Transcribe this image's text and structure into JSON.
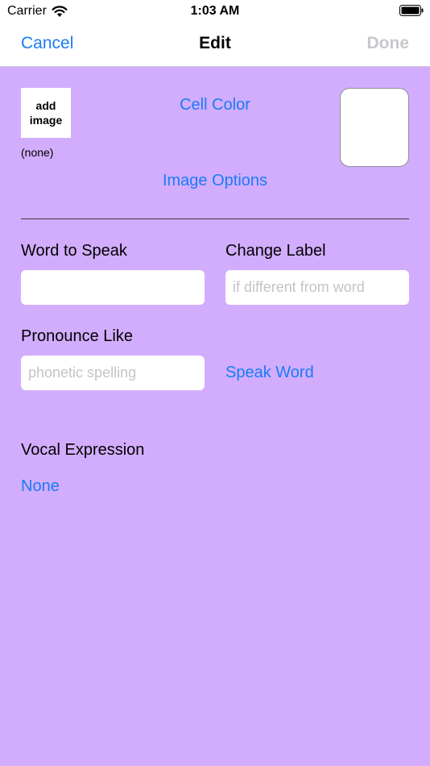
{
  "status_bar": {
    "carrier": "Carrier",
    "time": "1:03 AM",
    "wifi_icon": "wifi-icon",
    "battery_icon": "battery-icon"
  },
  "nav": {
    "cancel_label": "Cancel",
    "title": "Edit",
    "done_label": "Done"
  },
  "image_section": {
    "add_image_line1": "add",
    "add_image_line2": "image",
    "image_name": "(none)",
    "cell_color_label": "Cell Color",
    "image_options_label": "Image Options",
    "swatch_color": "#ffffff"
  },
  "word_to_speak": {
    "label": "Word to Speak",
    "value": "",
    "placeholder": ""
  },
  "change_label": {
    "label": "Change Label",
    "value": "",
    "placeholder": "if different from word"
  },
  "pronounce_like": {
    "label": "Pronounce Like",
    "value": "",
    "placeholder": "phonetic spelling"
  },
  "speak_word_label": "Speak Word",
  "vocal_expression": {
    "label": "Vocal Expression",
    "value": "None"
  },
  "colors": {
    "background": "#d2adfd",
    "accent": "#1a7cf5",
    "disabled": "#c7c7cc"
  }
}
